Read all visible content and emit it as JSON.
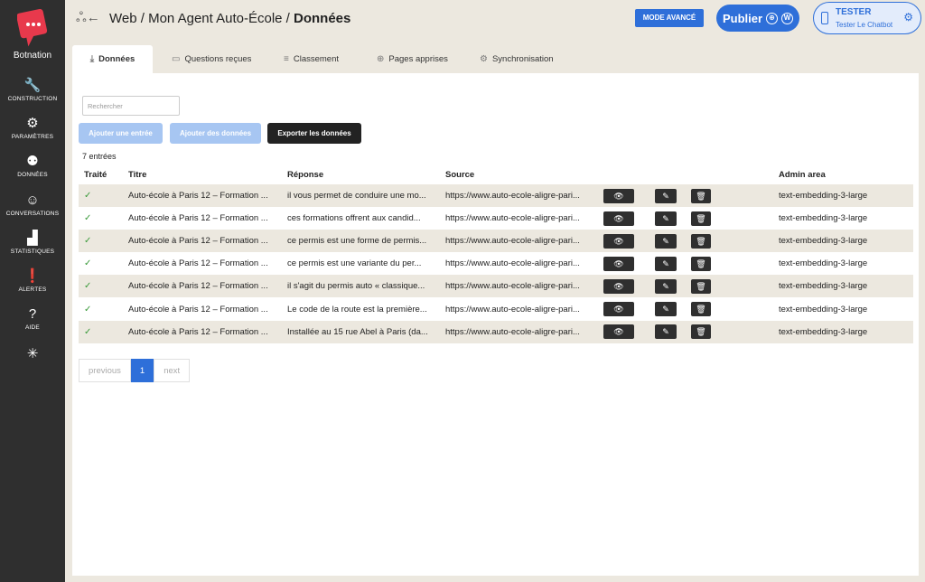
{
  "sidebar": {
    "brand": "Botnation",
    "items": [
      {
        "label": "CONSTRUCTION",
        "icon": "wrench-icon",
        "glyph": "🔧"
      },
      {
        "label": "PARAMÈTRES",
        "icon": "gear-icon",
        "glyph": "⚙"
      },
      {
        "label": "DONNÉES",
        "icon": "data-icon",
        "glyph": "⚉"
      },
      {
        "label": "CONVERSATIONS",
        "icon": "conversations-icon",
        "glyph": "☺"
      },
      {
        "label": "STATISTIQUES",
        "icon": "stats-icon",
        "glyph": "▟"
      },
      {
        "label": "ALERTES",
        "icon": "alert-icon",
        "glyph": "❗"
      },
      {
        "label": "AIDE",
        "icon": "help-icon",
        "glyph": "?"
      },
      {
        "label": "",
        "icon": "star-icon",
        "glyph": "✳"
      }
    ]
  },
  "header": {
    "crumb_prefix": "Web / Mon Agent Auto-École / ",
    "crumb_current": "Données",
    "advanced_label": "MODE AVANCÉ",
    "publish_label": "Publier",
    "tester_title": "TESTER",
    "tester_subtitle": "Tester Le Chatbot"
  },
  "tabs": [
    {
      "label": "Données",
      "icon": "download-icon",
      "glyph": "⤓"
    },
    {
      "label": "Questions reçues",
      "icon": "message-icon",
      "glyph": "▭"
    },
    {
      "label": "Classement",
      "icon": "list-icon",
      "glyph": "≡"
    },
    {
      "label": "Pages apprises",
      "icon": "globe-icon",
      "glyph": "⊕"
    },
    {
      "label": "Synchronisation",
      "icon": "gear-icon",
      "glyph": "⚙"
    }
  ],
  "search": {
    "placeholder": "Rechercher"
  },
  "actions": {
    "add_entry": "Ajouter une entrée",
    "add_data": "Ajouter des données",
    "export": "Exporter les données"
  },
  "count_label": "7 entrées",
  "table": {
    "headers": [
      "Traité",
      "Titre",
      "Réponse",
      "Source",
      "",
      "",
      "",
      "Admin area"
    ],
    "rows": [
      {
        "check": "✓",
        "title": "Auto-école à Paris 12 – Formation ...",
        "answer": "il vous permet de conduire une mo...",
        "source": "https://www.auto-ecole-aligre-pari...",
        "admin": "text-embedding-3-large"
      },
      {
        "check": "✓",
        "title": "Auto-école à Paris 12 – Formation ...",
        "answer": "ces formations offrent aux candid...",
        "source": "https://www.auto-ecole-aligre-pari...",
        "admin": "text-embedding-3-large"
      },
      {
        "check": "✓",
        "title": "Auto-école à Paris 12 – Formation ...",
        "answer": "ce permis est une forme de permis...",
        "source": "https://www.auto-ecole-aligre-pari...",
        "admin": "text-embedding-3-large"
      },
      {
        "check": "✓",
        "title": "Auto-école à Paris 12 – Formation ...",
        "answer": "ce permis est une variante du per...",
        "source": "https://www.auto-ecole-aligre-pari...",
        "admin": "text-embedding-3-large"
      },
      {
        "check": "✓",
        "title": "Auto-école à Paris 12 – Formation ...",
        "answer": "il s'agit du permis auto « classique...",
        "source": "https://www.auto-ecole-aligre-pari...",
        "admin": "text-embedding-3-large"
      },
      {
        "check": "✓",
        "title": "Auto-école à Paris 12 – Formation ...",
        "answer": "Le code de la route est la première...",
        "source": "https://www.auto-ecole-aligre-pari...",
        "admin": "text-embedding-3-large"
      },
      {
        "check": "✓",
        "title": "Auto-école à Paris 12 – Formation ...",
        "answer": "Installée au 15 rue Abel à Paris (da...",
        "source": "https://www.auto-ecole-aligre-pari...",
        "admin": "text-embedding-3-large"
      }
    ],
    "row_icons": {
      "eye": "👁",
      "edit": "✎",
      "delete": "🗑"
    }
  },
  "pagination": {
    "previous": "previous",
    "current": "1",
    "next": "next"
  },
  "colors": {
    "accent": "#2e6fd9",
    "sidebar": "#2f2f2f",
    "brand": "#e8394c",
    "check": "#3a9a3a"
  }
}
